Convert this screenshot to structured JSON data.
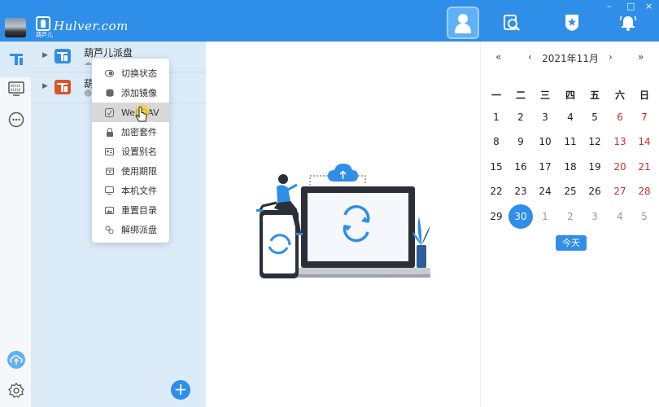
{
  "app": {
    "logo_text": "Hulver.com",
    "logo_subtitle": "葫芦儿",
    "window_controls": [
      "–",
      "□",
      "×"
    ]
  },
  "topbar": {
    "buttons": [
      {
        "icon": "user-icon",
        "active": true
      },
      {
        "icon": "search-doc-icon",
        "active": false
      },
      {
        "icon": "shield-star-icon",
        "active": false
      },
      {
        "icon": "bell-icon",
        "active": false
      }
    ]
  },
  "sidebar": {
    "items": [
      {
        "icon": "disk-icon",
        "active": true
      },
      {
        "icon": "binary-icon",
        "active": false
      },
      {
        "icon": "chat-icon",
        "active": false
      }
    ],
    "bottom": [
      {
        "icon": "upload-cloud-icon"
      },
      {
        "icon": "settings-icon"
      }
    ]
  },
  "disks": [
    {
      "name": "葫芦儿派盘",
      "sub": "",
      "color": "#2f8ee8"
    },
    {
      "name": "葫",
      "sub": "",
      "color": "#d9542c"
    }
  ],
  "context_menu": {
    "items": [
      {
        "label": "切换状态",
        "icon": "toggle-icon"
      },
      {
        "label": "添加镜像",
        "icon": "database-icon"
      },
      {
        "label": "WebDAV",
        "icon": "webdav-icon",
        "hover": true
      },
      {
        "label": "加密套件",
        "icon": "lock-icon"
      },
      {
        "label": "设置别名",
        "icon": "id-card-icon"
      },
      {
        "label": "使用期限",
        "icon": "calendar-icon"
      },
      {
        "label": "本机文件",
        "icon": "monitor-icon"
      },
      {
        "label": "重置目录",
        "icon": "image-icon"
      },
      {
        "label": "解绑派盘",
        "icon": "unlink-icon"
      }
    ]
  },
  "calendar": {
    "title": "2021年11月",
    "nav": {
      "prev_year": "«",
      "prev_month": "‹",
      "next_month": "›",
      "next_year": "»"
    },
    "weekdays": [
      "一",
      "二",
      "三",
      "四",
      "五",
      "六",
      "日"
    ],
    "weeks": [
      [
        1,
        2,
        3,
        4,
        5,
        6,
        7
      ],
      [
        8,
        9,
        10,
        11,
        12,
        13,
        14
      ],
      [
        15,
        16,
        17,
        18,
        19,
        20,
        21
      ],
      [
        22,
        23,
        24,
        25,
        26,
        27,
        28
      ],
      [
        29,
        30,
        1,
        2,
        3,
        4,
        5
      ]
    ],
    "selected": 30,
    "today_label": "今天",
    "colors": {
      "accent": "#2f8ee8",
      "weekend": "#c8312b",
      "muted": "#999999"
    }
  }
}
